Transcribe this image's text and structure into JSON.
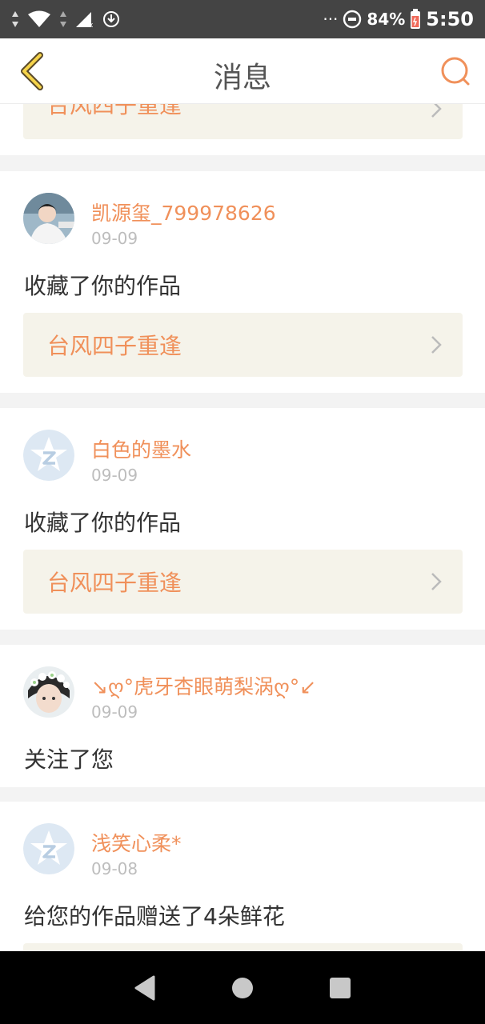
{
  "status_bar": {
    "dots": "···",
    "battery": "84%",
    "time": "5:50"
  },
  "header": {
    "title": "消息"
  },
  "colors": {
    "accent": "#f0905a",
    "card_bg": "#ffffff",
    "work_bg": "#f5f3ea",
    "divider": "#f3f3f3"
  },
  "messages": [
    {
      "work_title": "台风四子重逢"
    },
    {
      "user": "凯源玺_799978626",
      "date": "09-09",
      "action": "收藏了你的作品",
      "work_title": "台风四子重逢",
      "avatar": "photo-avatar"
    },
    {
      "user": "白色的墨水",
      "date": "09-09",
      "action": "收藏了你的作品",
      "work_title": "台风四子重逢",
      "avatar": "default-star-avatar"
    },
    {
      "user": "↘ღ°虎牙杏眼萌梨涡ღ°↙",
      "date": "09-09",
      "action": "关注了您",
      "avatar": "photo-avatar"
    },
    {
      "user": "浅笑心柔*",
      "date": "09-08",
      "action": "给您的作品赠送了4朵鲜花",
      "avatar": "default-star-avatar"
    }
  ]
}
